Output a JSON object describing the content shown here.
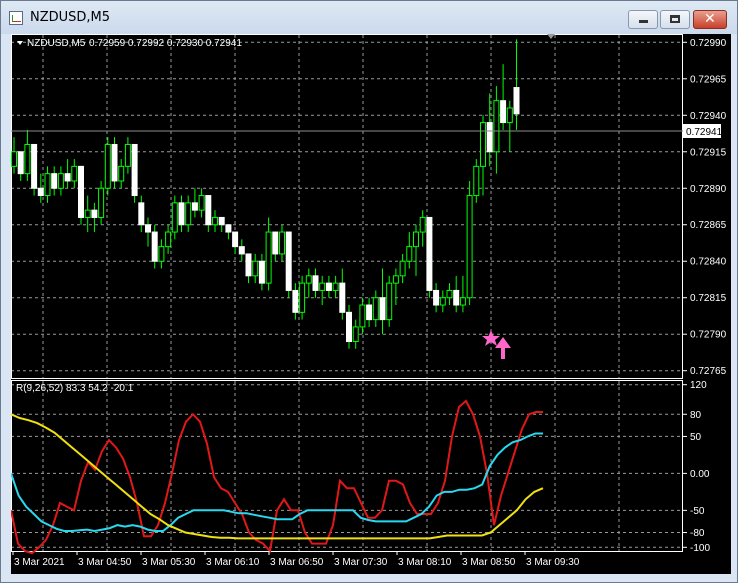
{
  "window": {
    "title": "NZDUSD,M5"
  },
  "price_panel": {
    "symbol_label": "NZDUSD,M5",
    "ohlc_label": "0.72959 0.72992 0.72930 0.72941",
    "current_price": "0.72941",
    "price_ticks": [
      "0.72990",
      "0.72965",
      "0.72940",
      "0.72915",
      "0.72890",
      "0.72865",
      "0.72840",
      "0.72815",
      "0.72790",
      "0.72765"
    ]
  },
  "indicator_panel": {
    "label": "R(9,26,52) 83.3 54.2 -20.1",
    "ticks": [
      "120",
      "80",
      "50",
      "0.00",
      "-50",
      "-80",
      "-100"
    ]
  },
  "time_axis": {
    "labels": [
      "3 Mar 2021",
      "3 Mar 04:50",
      "3 Mar 05:30",
      "3 Mar 06:10",
      "3 Mar 06:50",
      "3 Mar 07:30",
      "3 Mar 08:10",
      "3 Mar 08:50",
      "3 Mar 09:30"
    ]
  },
  "chart_data": {
    "type": "candlestick",
    "price": {
      "ylim": [
        0.7276,
        0.72995
      ],
      "candles": [
        [
          0.72905,
          0.72925,
          0.729,
          0.72915
        ],
        [
          0.72915,
          0.72915,
          0.72895,
          0.729
        ],
        [
          0.729,
          0.7293,
          0.72895,
          0.7292
        ],
        [
          0.7292,
          0.7292,
          0.72885,
          0.7289
        ],
        [
          0.7289,
          0.729,
          0.7288,
          0.72885
        ],
        [
          0.72885,
          0.72905,
          0.7288,
          0.729
        ],
        [
          0.729,
          0.72905,
          0.72885,
          0.7289
        ],
        [
          0.7289,
          0.72905,
          0.72885,
          0.729
        ],
        [
          0.729,
          0.7291,
          0.7289,
          0.72895
        ],
        [
          0.72895,
          0.7291,
          0.7289,
          0.72905
        ],
        [
          0.72905,
          0.72905,
          0.72865,
          0.7287
        ],
        [
          0.7287,
          0.72885,
          0.7286,
          0.72875
        ],
        [
          0.72875,
          0.7288,
          0.7286,
          0.7287
        ],
        [
          0.7287,
          0.72895,
          0.72865,
          0.7289
        ],
        [
          0.7289,
          0.72925,
          0.72885,
          0.7292
        ],
        [
          0.7292,
          0.72925,
          0.7289,
          0.72895
        ],
        [
          0.72895,
          0.7291,
          0.7289,
          0.72905
        ],
        [
          0.72905,
          0.72925,
          0.729,
          0.7292
        ],
        [
          0.7292,
          0.7292,
          0.7288,
          0.72885
        ],
        [
          0.7288,
          0.72885,
          0.7286,
          0.72865
        ],
        [
          0.72865,
          0.7287,
          0.7285,
          0.7286
        ],
        [
          0.7286,
          0.72865,
          0.72835,
          0.7284
        ],
        [
          0.7284,
          0.72855,
          0.72835,
          0.7285
        ],
        [
          0.7285,
          0.72865,
          0.72845,
          0.7286
        ],
        [
          0.7286,
          0.72885,
          0.72855,
          0.7288
        ],
        [
          0.7288,
          0.72885,
          0.7286,
          0.72865
        ],
        [
          0.72865,
          0.72885,
          0.7286,
          0.7288
        ],
        [
          0.7288,
          0.7289,
          0.7287,
          0.72875
        ],
        [
          0.72875,
          0.7289,
          0.7287,
          0.72885
        ],
        [
          0.72885,
          0.72885,
          0.7286,
          0.72865
        ],
        [
          0.72865,
          0.72875,
          0.7286,
          0.7287
        ],
        [
          0.7287,
          0.7287,
          0.7286,
          0.72865
        ],
        [
          0.72865,
          0.72865,
          0.72855,
          0.7286
        ],
        [
          0.7286,
          0.7286,
          0.72845,
          0.7285
        ],
        [
          0.7285,
          0.72855,
          0.7284,
          0.72845
        ],
        [
          0.72845,
          0.72845,
          0.72825,
          0.7283
        ],
        [
          0.7283,
          0.72845,
          0.72825,
          0.7284
        ],
        [
          0.7284,
          0.72845,
          0.7282,
          0.72825
        ],
        [
          0.72825,
          0.7287,
          0.7282,
          0.7286
        ],
        [
          0.7286,
          0.7286,
          0.7284,
          0.72845
        ],
        [
          0.72845,
          0.72865,
          0.7284,
          0.7286
        ],
        [
          0.7286,
          0.7286,
          0.72815,
          0.7282
        ],
        [
          0.7282,
          0.72825,
          0.728,
          0.72805
        ],
        [
          0.72805,
          0.7283,
          0.728,
          0.72825
        ],
        [
          0.72825,
          0.72835,
          0.72815,
          0.7283
        ],
        [
          0.7283,
          0.72835,
          0.72815,
          0.7282
        ],
        [
          0.7282,
          0.7283,
          0.7281,
          0.72825
        ],
        [
          0.72825,
          0.7283,
          0.72815,
          0.7282
        ],
        [
          0.7282,
          0.7283,
          0.72815,
          0.72825
        ],
        [
          0.72825,
          0.72835,
          0.728,
          0.72805
        ],
        [
          0.72805,
          0.7281,
          0.7278,
          0.72785
        ],
        [
          0.72785,
          0.728,
          0.7278,
          0.72795
        ],
        [
          0.72795,
          0.72815,
          0.7279,
          0.7281
        ],
        [
          0.7281,
          0.72815,
          0.72795,
          0.728
        ],
        [
          0.728,
          0.7282,
          0.72795,
          0.72815
        ],
        [
          0.72815,
          0.72835,
          0.7279,
          0.728
        ],
        [
          0.728,
          0.7283,
          0.72795,
          0.72825
        ],
        [
          0.72825,
          0.72835,
          0.7281,
          0.7283
        ],
        [
          0.7283,
          0.72845,
          0.72825,
          0.7284
        ],
        [
          0.7284,
          0.7286,
          0.72835,
          0.7285
        ],
        [
          0.7285,
          0.72865,
          0.7283,
          0.7286
        ],
        [
          0.7286,
          0.72875,
          0.7285,
          0.7287
        ],
        [
          0.7287,
          0.7287,
          0.72815,
          0.7282
        ],
        [
          0.7282,
          0.72825,
          0.72805,
          0.7281
        ],
        [
          0.7281,
          0.7282,
          0.72805,
          0.72815
        ],
        [
          0.72815,
          0.72825,
          0.7281,
          0.7282
        ],
        [
          0.7282,
          0.7283,
          0.72805,
          0.7281
        ],
        [
          0.7281,
          0.7283,
          0.72805,
          0.72815
        ],
        [
          0.72815,
          0.72895,
          0.7281,
          0.72885
        ],
        [
          0.72885,
          0.7291,
          0.7288,
          0.72905
        ],
        [
          0.72905,
          0.7294,
          0.72885,
          0.72935
        ],
        [
          0.72935,
          0.72955,
          0.72905,
          0.72915
        ],
        [
          0.72915,
          0.7296,
          0.729,
          0.7295
        ],
        [
          0.7295,
          0.72975,
          0.7293,
          0.72935
        ],
        [
          0.72935,
          0.7295,
          0.72915,
          0.72945
        ],
        [
          0.72959,
          0.72992,
          0.7293,
          0.72941
        ]
      ]
    },
    "indicator": {
      "ylim": [
        -105,
        125
      ],
      "series": [
        {
          "name": "R(9)",
          "color": "#e01818",
          "values": [
            -50,
            -95,
            -105,
            -108,
            -100,
            -90,
            -70,
            -40,
            -45,
            -50,
            -10,
            15,
            5,
            30,
            45,
            35,
            20,
            -5,
            -40,
            -85,
            -85,
            -70,
            -40,
            0,
            45,
            70,
            80,
            70,
            40,
            -5,
            -20,
            -25,
            -40,
            -55,
            -80,
            -90,
            -95,
            -105,
            -50,
            -35,
            -50,
            -50,
            -80,
            -95,
            -95,
            -95,
            -70,
            -10,
            -20,
            -20,
            -40,
            -60,
            -60,
            -50,
            -10,
            -10,
            -15,
            -40,
            -55,
            -55,
            -55,
            -40,
            -10,
            50,
            90,
            98,
            80,
            50,
            0,
            -70,
            -30,
            0,
            30,
            60,
            80,
            83,
            83
          ]
        },
        {
          "name": "R(26)",
          "color": "#28d8f0",
          "values": [
            0,
            -30,
            -45,
            -55,
            -65,
            -70,
            -75,
            -78,
            -78,
            -77,
            -76,
            -78,
            -76,
            -74,
            -70,
            -72,
            -70,
            -72,
            -76,
            -78,
            -78,
            -70,
            -60,
            -55,
            -50,
            -50,
            -50,
            -50,
            -50,
            -52,
            -54,
            -54,
            -56,
            -58,
            -60,
            -62,
            -62,
            -62,
            -55,
            -50,
            -50,
            -50,
            -50,
            -50,
            -50,
            -50,
            -60,
            -63,
            -65,
            -65,
            -65,
            -65,
            -65,
            -60,
            -55,
            -45,
            -30,
            -25,
            -25,
            -22,
            -22,
            -20,
            -15,
            10,
            25,
            35,
            42,
            45,
            50,
            54,
            54
          ]
        },
        {
          "name": "R(52)",
          "color": "#f0e010",
          "values": [
            80,
            75,
            72,
            68,
            62,
            55,
            45,
            35,
            25,
            15,
            5,
            -5,
            -15,
            -25,
            -35,
            -45,
            -55,
            -62,
            -70,
            -75,
            -80,
            -82,
            -84,
            -86,
            -87,
            -87,
            -88,
            -88,
            -88,
            -88,
            -88,
            -88,
            -88,
            -88,
            -88,
            -88,
            -88,
            -88,
            -88,
            -88,
            -88,
            -88,
            -88,
            -88,
            -88,
            -88,
            -88,
            -88,
            -88,
            -86,
            -84,
            -84,
            -84,
            -84,
            -84,
            -80,
            -70,
            -60,
            -50,
            -35,
            -25,
            -20
          ]
        }
      ]
    }
  }
}
